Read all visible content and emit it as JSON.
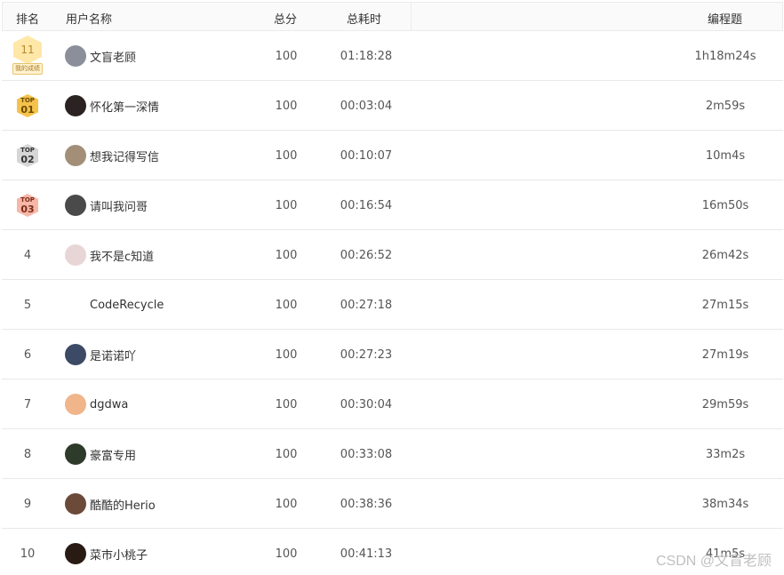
{
  "headers": {
    "rank": "排名",
    "user": "用户名称",
    "score": "总分",
    "total_time": "总耗时",
    "prog_time": "编程题"
  },
  "my_rank": {
    "rank": "11",
    "label": "我的成绩",
    "name": "文盲老顾",
    "score": "100",
    "total_time": "01:18:28",
    "prog_time": "1h18m24s",
    "avatar_color": "#8a8f99"
  },
  "rows": [
    {
      "rank": "01",
      "badge_top": "TOP",
      "badge_color": "#f5c24c",
      "badge_text_color": "#6b4a00",
      "name": "怀化第一深情",
      "score": "100",
      "total_time": "00:03:04",
      "prog_time": "2m59s",
      "avatar_color": "#2b2322"
    },
    {
      "rank": "02",
      "badge_top": "TOP",
      "badge_color": "#d6d6d6",
      "badge_text_color": "#333333",
      "name": "想我记得写信",
      "score": "100",
      "total_time": "00:10:07",
      "prog_time": "10m4s",
      "avatar_color": "#a38f78"
    },
    {
      "rank": "03",
      "badge_top": "TOP",
      "badge_color": "#f7b7a8",
      "badge_text_color": "#7a2b18",
      "name": "请叫我问哥",
      "score": "100",
      "total_time": "00:16:54",
      "prog_time": "16m50s",
      "avatar_color": "#4a4a4a"
    },
    {
      "rank": "4",
      "name": "我不是c知道",
      "score": "100",
      "total_time": "00:26:52",
      "prog_time": "26m42s",
      "avatar_color": "#e8d6d6"
    },
    {
      "rank": "5",
      "name": "CodeRecycle",
      "score": "100",
      "total_time": "00:27:18",
      "prog_time": "27m15s",
      "avatar_color": ""
    },
    {
      "rank": "6",
      "name": "是诺诺吖",
      "score": "100",
      "total_time": "00:27:23",
      "prog_time": "27m19s",
      "avatar_color": "#3d4a66"
    },
    {
      "rank": "7",
      "name": "dgdwa",
      "score": "100",
      "total_time": "00:30:04",
      "prog_time": "29m59s",
      "avatar_color": "#f0b58a"
    },
    {
      "rank": "8",
      "name": "豪富专用",
      "score": "100",
      "total_time": "00:33:08",
      "prog_time": "33m2s",
      "avatar_color": "#2e3a2a"
    },
    {
      "rank": "9",
      "name": "酷酷的Herio",
      "score": "100",
      "total_time": "00:38:36",
      "prog_time": "38m34s",
      "avatar_color": "#6b4a3a"
    },
    {
      "rank": "10",
      "name": "菜市小桃子",
      "score": "100",
      "total_time": "00:41:13",
      "prog_time": "41m5s",
      "avatar_color": "#2a1a14"
    }
  ],
  "watermark": "CSDN @文盲老顾"
}
